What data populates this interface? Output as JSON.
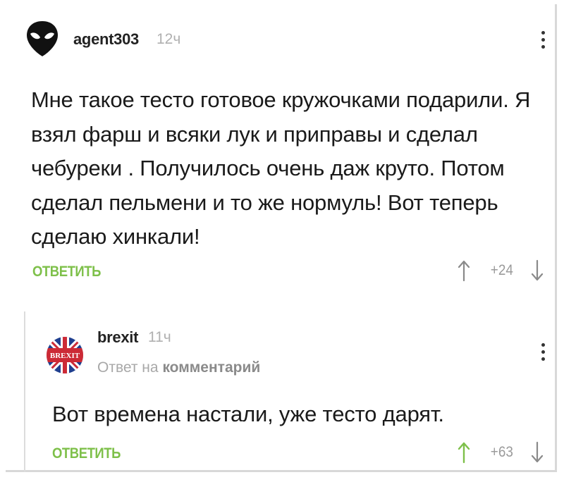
{
  "comments": [
    {
      "username": "agent303",
      "time": "12ч",
      "text": "Мне такое тесто готовое кружочками подарили. Я взял фарш и всяки лук и приправы и сделал чебуреки . Получилось очень даж круто. Потом сделал пельмени и то же нормуль! Вот теперь сделаю хинкали!",
      "reply_label": "ОТВЕТИТЬ",
      "score": "+24",
      "avatar_icon": "alien-head-icon"
    },
    {
      "username": "brexit",
      "time": "11ч",
      "reply_to_prefix": "Ответ на",
      "reply_to_target": "комментарий",
      "text": "Вот времена настали, уже тесто дарят.",
      "reply_label": "ОТВЕТИТЬ",
      "score": "+63",
      "avatar_icon": "brexit-flag-icon",
      "avatar_text": "BREXIT"
    }
  ],
  "colors": {
    "accent_green": "#7ec04a",
    "upvoted_green": "#7ec04a",
    "muted_gray": "#b0b0b0"
  }
}
